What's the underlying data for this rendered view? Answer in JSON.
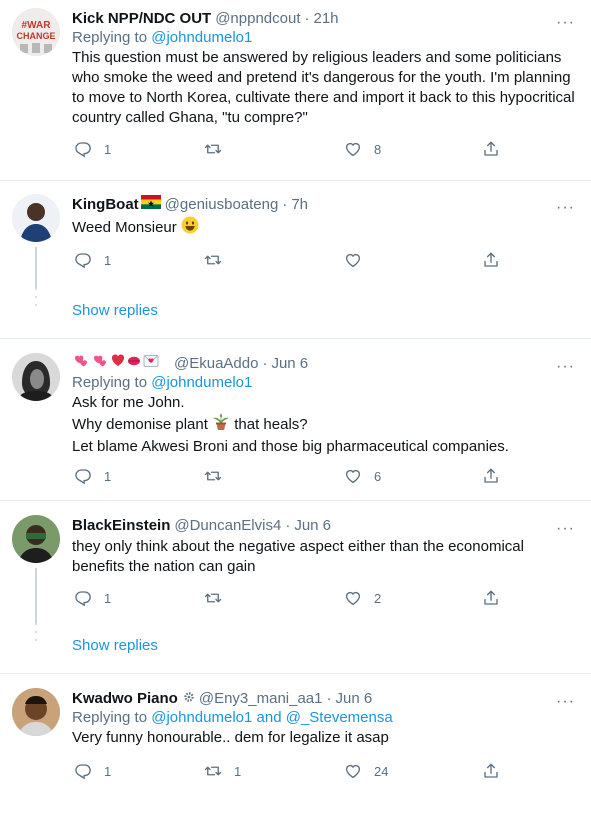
{
  "tweets": [
    {
      "name": "Kick NPP/NDC OUT",
      "handle": "@nppndcout",
      "time": "21h",
      "reply_label": "Replying to",
      "reply_to": "@johndumelo1",
      "reply_to_2": "",
      "body": "This question must be answered by religious leaders and some politicians who smoke the weed and pretend it's dangerous for the youth. I'm planning to move to North Korea, cultivate there and import it back to this hypocritical country called Ghana, \"tu compre?\"",
      "replies": "1",
      "retweets": "",
      "likes": "8"
    },
    {
      "name": "KingBoat",
      "handle": "@geniusboateng",
      "time": "7h",
      "body": "Weed Monsieur",
      "replies": "1",
      "retweets": "",
      "likes": ""
    },
    {
      "name": "",
      "handle": "@EkuaAddo",
      "time": "Jun 6",
      "reply_label": "Replying to",
      "reply_to": "@johndumelo1",
      "body_line1": "Ask for me John.",
      "body_line2a": "Why demonise plant",
      "body_line2b": "that heals?",
      "body_line3": "Let blame Akwesi Broni and those big pharmaceutical companies.",
      "replies": "1",
      "retweets": "",
      "likes": "6"
    },
    {
      "name": "BlackEinstein",
      "handle": "@DuncanElvis4",
      "time": "Jun 6",
      "body": "they only think about the negative aspect either than the economical benefits the nation can gain",
      "replies": "1",
      "retweets": "",
      "likes": "2"
    },
    {
      "name": "Kwadwo Piano",
      "handle": "@Eny3_mani_aa1",
      "time": "Jun 6",
      "reply_label": "Replying to",
      "reply_to": "@johndumelo1",
      "reply_and": "and",
      "reply_to_2": "@_Stevemensa",
      "body": "Very funny honourable.. dem for legalize it asap",
      "replies": "1",
      "retweets": "1",
      "likes": "24"
    }
  ],
  "show_replies_label": "Show replies",
  "more_label": "···",
  "dot": "·",
  "colors": {
    "accent": "#1b95e0",
    "muted": "#5b7083",
    "border": "#e6ecf0"
  }
}
